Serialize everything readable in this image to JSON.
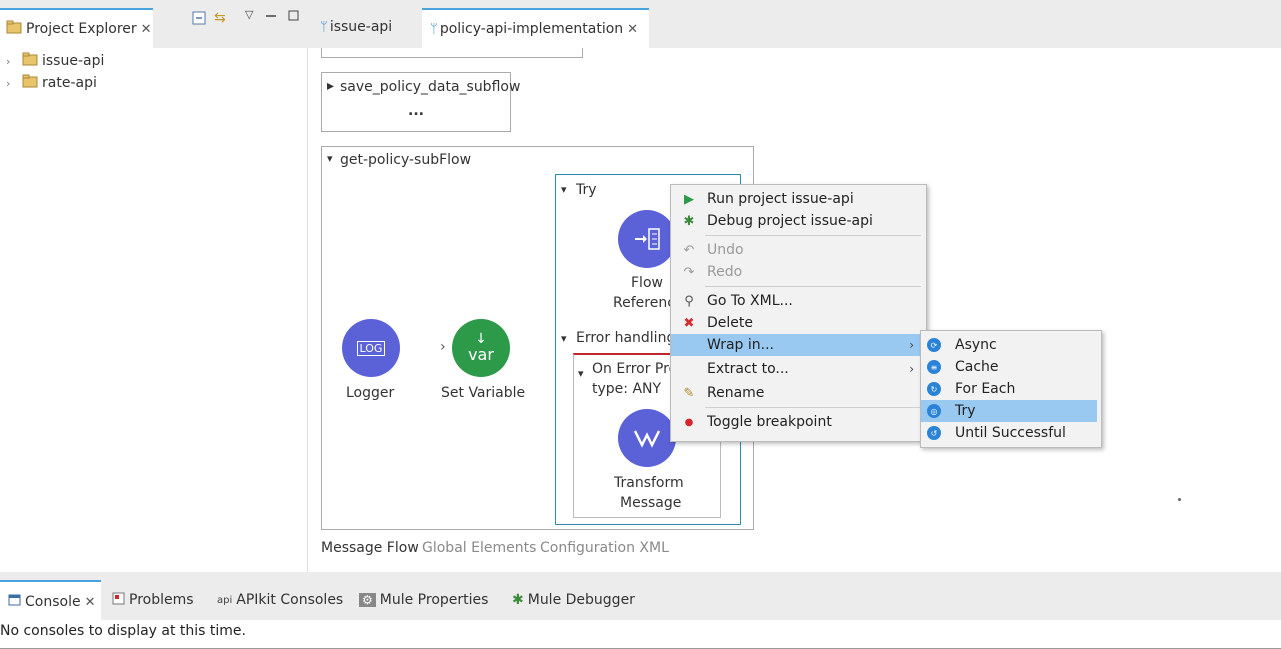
{
  "explorer": {
    "tab_label": "Project Explorer",
    "items": [
      {
        "label": "issue-api"
      },
      {
        "label": "rate-api"
      }
    ]
  },
  "editor_tabs": [
    {
      "label": "issue-api"
    },
    {
      "label": "policy-api-implementation"
    }
  ],
  "canvas": {
    "save_flow_title": "save_policy_data_subflow",
    "save_flow_more": "...",
    "get_flow_title": "get-policy-subFlow",
    "try_label": "Try",
    "error_handling_label": "Error handling",
    "on_error_line1": "On Error Pro",
    "on_error_line2": "type: ANY",
    "logger_label": "Logger",
    "logger_icon_text": "LOG",
    "set_variable_label": "Set Variable",
    "set_variable_icon_text": "var",
    "flow_ref_line1": "Flow",
    "flow_ref_line2": "Referenc",
    "transform_line1": "Transform",
    "transform_line2": "Message",
    "accent": "#5b61d6",
    "green": "#2d9a4a"
  },
  "editor_bottom_tabs": [
    "Message Flow",
    "Global Elements",
    "Configuration XML"
  ],
  "context_menu": {
    "items": [
      {
        "label": "Run project issue-api"
      },
      {
        "label": "Debug project issue-api"
      },
      {
        "label": "Undo"
      },
      {
        "label": "Redo"
      },
      {
        "label": "Go To XML..."
      },
      {
        "label": "Delete"
      },
      {
        "label": "Wrap in..."
      },
      {
        "label": "Extract to..."
      },
      {
        "label": "Rename"
      },
      {
        "label": "Toggle breakpoint"
      }
    ]
  },
  "wrap_submenu": {
    "items": [
      {
        "label": "Async"
      },
      {
        "label": "Cache"
      },
      {
        "label": "For Each"
      },
      {
        "label": "Try"
      },
      {
        "label": "Until Successful"
      }
    ]
  },
  "console_tabs": [
    "Console",
    "Problems",
    "APIkit Consoles",
    "Mule Properties",
    "Mule Debugger"
  ],
  "console_apikit_prefix": "api",
  "console_message": "No consoles to display at this time."
}
